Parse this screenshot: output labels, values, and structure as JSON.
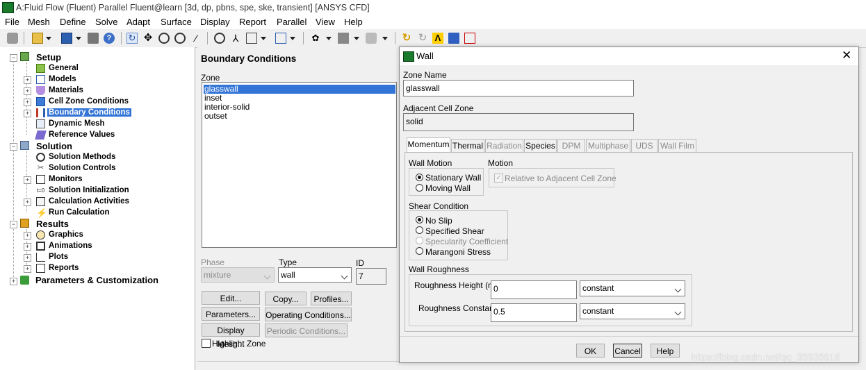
{
  "window": {
    "title": "A:Fluid Flow (Fluent) Parallel Fluent@learn  [3d, dp, pbns, spe, ske, transient] [ANSYS CFD]"
  },
  "menu": [
    "File",
    "Mesh",
    "Define",
    "Solve",
    "Adapt",
    "Surface",
    "Display",
    "Report",
    "Parallel",
    "View",
    "Help"
  ],
  "tree": {
    "setup": "Setup",
    "setup_items": [
      "General",
      "Models",
      "Materials",
      "Cell Zone Conditions",
      "Boundary Conditions",
      "Dynamic Mesh",
      "Reference Values"
    ],
    "solution": "Solution",
    "solution_items": [
      "Solution Methods",
      "Solution Controls",
      "Monitors",
      "Solution Initialization",
      "Calculation Activities",
      "Run Calculation"
    ],
    "results": "Results",
    "results_items": [
      "Graphics",
      "Animations",
      "Plots",
      "Reports"
    ],
    "params": "Parameters & Customization"
  },
  "bc": {
    "title": "Boundary Conditions",
    "zone_label": "Zone",
    "zones": [
      "glasswall",
      "inset",
      "interior-solid",
      "outset"
    ],
    "phase_label": "Phase",
    "phase_value": "mixture",
    "type_label": "Type",
    "type_value": "wall",
    "id_label": "ID",
    "id_value": "7",
    "edit": "Edit...",
    "copy": "Copy...",
    "profiles": "Profiles...",
    "parameters": "Parameters...",
    "operating": "Operating Conditions...",
    "display_mesh": "Display Mesh...",
    "periodic": "Periodic Conditions...",
    "highlight": "Highlight Zone"
  },
  "wall": {
    "title": "Wall",
    "zone_name_label": "Zone Name",
    "zone_name": "glasswall",
    "adjacent_label": "Adjacent Cell Zone",
    "adjacent": "solid",
    "tabs": [
      "Momentum",
      "Thermal",
      "Radiation",
      "Species",
      "DPM",
      "Multiphase",
      "UDS",
      "Wall Film"
    ],
    "wall_motion_label": "Wall Motion",
    "stationary": "Stationary Wall",
    "moving": "Moving Wall",
    "motion_label": "Motion",
    "relative": "Relative to Adjacent Cell Zone",
    "shear_label": "Shear Condition",
    "no_slip": "No Slip",
    "specified_shear": "Specified Shear",
    "specularity": "Specularity Coefficient",
    "marangoni": "Marangoni Stress",
    "roughness_label": "Wall Roughness",
    "rough_height_label": "Roughness Height (m)",
    "rough_height": "0",
    "rough_height_method": "constant",
    "rough_const_label": "Roughness Constant",
    "rough_const": "0.5",
    "rough_const_method": "constant",
    "ok": "OK",
    "cancel": "Cancel",
    "help": "Help"
  },
  "watermark": "https://blog.csdn.net/qq_35535616",
  "colors": {
    "selection": "#3375d7",
    "app_green": "#1a7a2e"
  }
}
